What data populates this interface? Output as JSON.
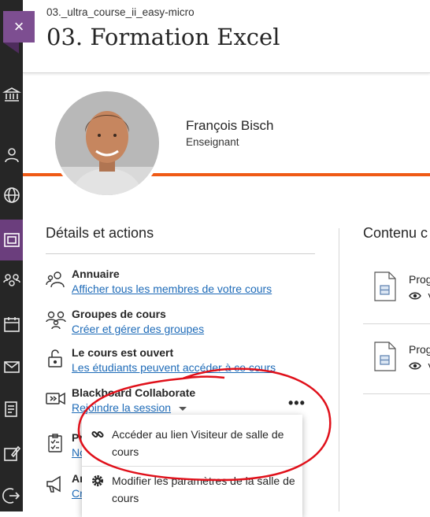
{
  "header": {
    "course_id": "03._ultra_course_ii_easy-micro",
    "course_title": "03. Formation Excel"
  },
  "close_icon": "×",
  "instructor": {
    "name": "François Bisch",
    "role": "Enseignant"
  },
  "details": {
    "title": "Détails et actions",
    "items": [
      {
        "label": "Annuaire",
        "link": "Afficher tous les membres de votre cours",
        "icon": "roster-icon"
      },
      {
        "label": "Groupes de cours",
        "link": "Créer et gérer des groupes",
        "icon": "groups-icon"
      },
      {
        "label": "Le cours est ouvert",
        "link": "Les étudiants peuvent accéder à ce cours",
        "icon": "unlock-icon"
      },
      {
        "label": "Blackboard Collaborate",
        "link": "Rejoindre la session",
        "icon": "video-icon"
      },
      {
        "label": "Pr",
        "link": "No",
        "icon": "checklist-icon"
      },
      {
        "label": "An",
        "link": "Cr",
        "icon": "megaphone-icon"
      }
    ],
    "more_label": "•••"
  },
  "content": {
    "title": "Contenu c",
    "items": [
      {
        "title": "Prog",
        "visibility": "V"
      },
      {
        "title": "Prog",
        "visibility": "V"
      }
    ]
  },
  "dropdown": {
    "items": [
      {
        "label": "Accéder au lien Visiteur de salle de cours",
        "icon": "link-icon"
      },
      {
        "label": "Modifier les paramètres de la salle de cours",
        "icon": "gear-icon"
      }
    ]
  },
  "colors": {
    "accent_orange": "#ef5a16",
    "nav_dark": "#262626",
    "nav_active": "#6b3e7d",
    "link_blue": "#1e6bb8",
    "annotation_red": "#e0101a"
  }
}
